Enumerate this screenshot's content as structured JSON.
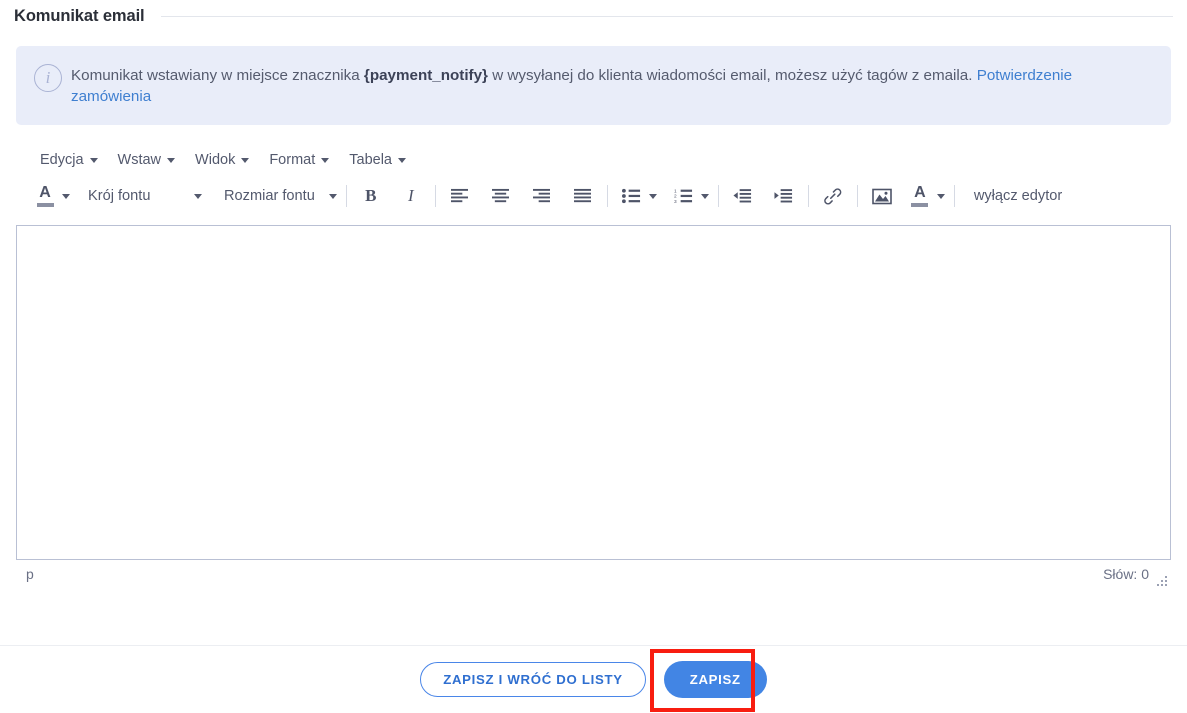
{
  "header": {
    "title": "Komunikat email"
  },
  "info_banner": {
    "icon": "info-circle-icon",
    "text_part1": "Komunikat wstawiany w miejsce znacznika ",
    "tag": "{payment_notify}",
    "text_part2": " w wysyłanej do klienta wiadomości email, możesz użyć tagów z emaila. ",
    "link": "Potwierdzenie zamówienia",
    "bg_color": "#e9edf9",
    "link_color": "#3f7fd0"
  },
  "editor": {
    "menubar": [
      {
        "label": "Edycja",
        "name": "menu-edycja"
      },
      {
        "label": "Wstaw",
        "name": "menu-wstaw"
      },
      {
        "label": "Widok",
        "name": "menu-widok"
      },
      {
        "label": "Format",
        "name": "menu-format"
      },
      {
        "label": "Tabela",
        "name": "menu-tabela"
      }
    ],
    "toolbar": {
      "text_color_label": "A",
      "font_family_label": "Krój fontu",
      "font_size_label": "Rozmiar fontu",
      "bold_label": "B",
      "italic_label": "I",
      "background_color_label": "A",
      "disable_editor_label": "wyłącz edytor"
    },
    "content": "",
    "statusbar": {
      "path": "p",
      "word_count": "Słów: 0"
    },
    "border_color": "#b9c0d4"
  },
  "footer": {
    "save_and_back_label": "ZAPISZ I WRÓĆ DO LISTY",
    "save_label": "ZAPISZ",
    "primary_color": "#4285e4",
    "outline_color": "#4a86e8",
    "highlight_color": "#f81d10"
  }
}
